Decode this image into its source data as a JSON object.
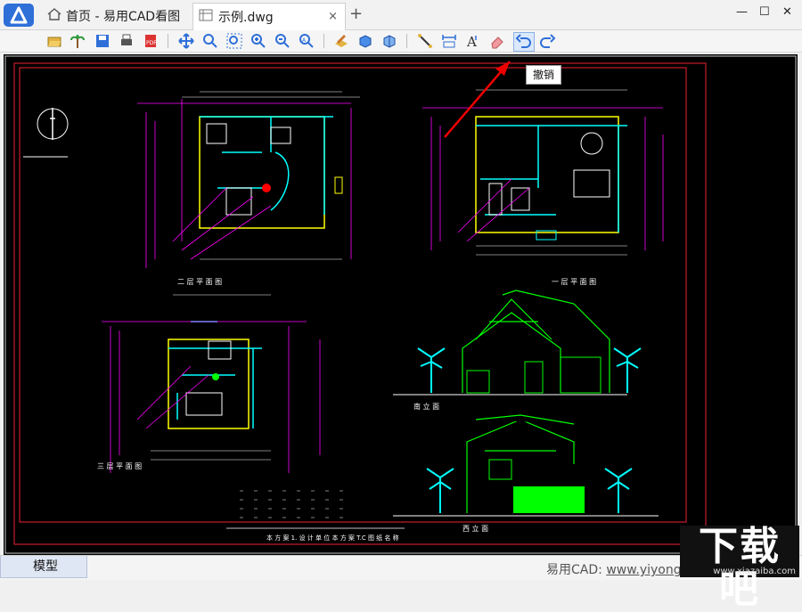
{
  "app": {
    "home_tab": "首页 - 易用CAD看图",
    "file_tab": "示例.dwg",
    "close_tab": "×",
    "new_tab": "+",
    "win_min": "—",
    "win_max": "☐",
    "win_close": "✕"
  },
  "tooltip": "撤销",
  "drawing": {
    "label_floor2": "二 层 平 面 图",
    "label_floor1": "一 层 平 面 图",
    "label_floor3": "三 层 平 面 图",
    "label_south": "南 立 面",
    "label_west": "西 立 面",
    "title_block": "本 方 案 1. 设 计 单 位  本 方 案 T.C  图 纸 名 称"
  },
  "status": {
    "model_tab": "模型",
    "app_label": "易用CAD: ",
    "url": "www.yiyongc"
  },
  "watermark": {
    "main": "下载吧",
    "sub": "www.xiazaiba.com"
  },
  "colors": {
    "canvas": "#000000",
    "accent": "#2f6fd8"
  }
}
